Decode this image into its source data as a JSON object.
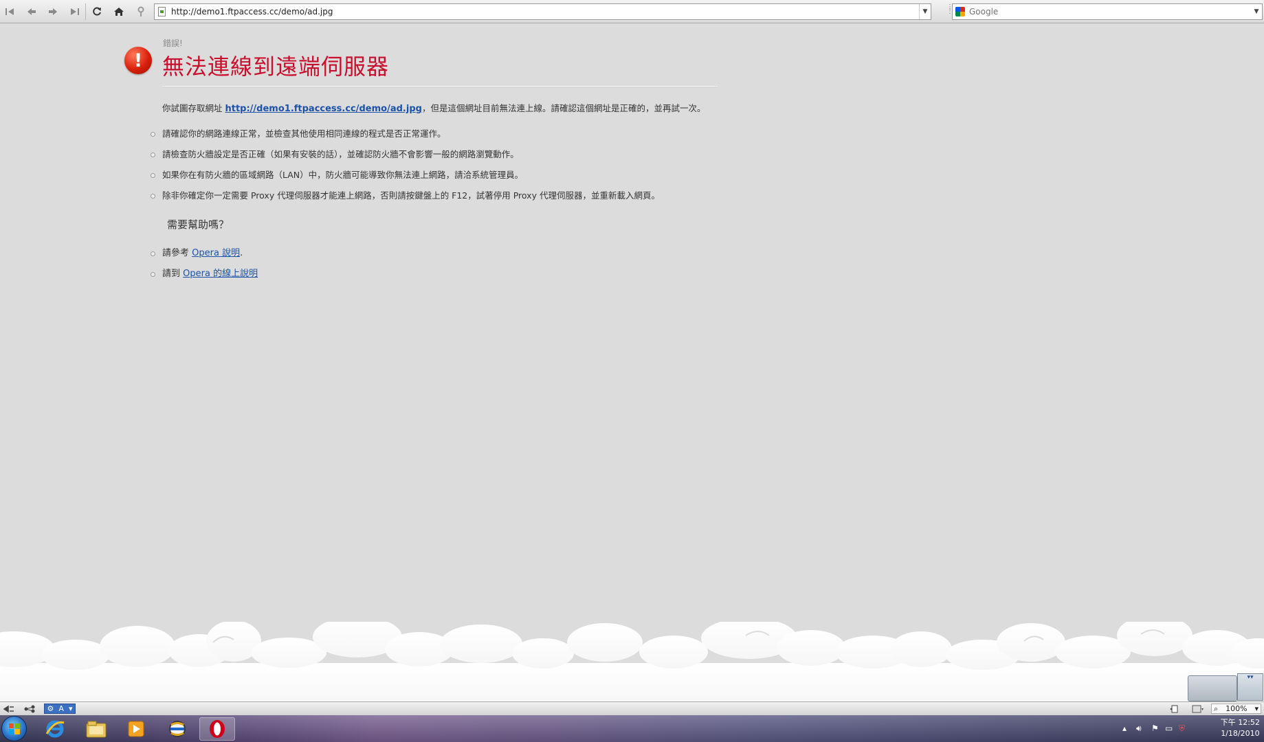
{
  "toolbar": {
    "address_value": "http://demo1.ftpaccess.cc/demo/ad.jpg",
    "search_placeholder": "Google",
    "icons": [
      "rewind-icon",
      "back-icon",
      "forward-icon",
      "fast-forward-icon",
      "reload-icon",
      "home-icon",
      "key-icon"
    ]
  },
  "error": {
    "label": "錯誤!",
    "title": "無法連線到遠端伺服器",
    "intro_prefix": "你試圖存取網址 ",
    "intro_link": "http://demo1.ftpaccess.cc/demo/ad.jpg",
    "intro_suffix": "，但是這個網址目前無法連上線。請確認這個網址是正確的，並再試一次。",
    "bullets": [
      "請確認你的網路連線正常，並檢查其他使用相同連線的程式是否正常運作。",
      "請檢查防火牆設定是否正確（如果有安裝的話），並確認防火牆不會影響一般的網路瀏覽動作。",
      "如果你在有防火牆的區域網路（LAN）中，防火牆可能導致你無法連上網路，請洽系統管理員。",
      "除非你確定你一定需要 Proxy 代理伺服器才能連上網路，否則請按鍵盤上的 F12，試著停用 Proxy 代理伺服器，並重新載入網頁。"
    ]
  },
  "help": {
    "heading": "需要幫助嗎？",
    "items": [
      {
        "prefix": "請參考 ",
        "link": "Opera 說明",
        "suffix": "."
      },
      {
        "prefix": "請到 ",
        "link": "Opera 的線上說明",
        "suffix": ""
      }
    ]
  },
  "statusbar": {
    "view_label": "A",
    "zoom": "100%"
  },
  "taskbar": {
    "apps": [
      "windows-start",
      "internet-explorer",
      "windows-explorer",
      "media-player",
      "ie-alt",
      "opera"
    ],
    "clock_time": "下午 12:52",
    "clock_date": "1/18/2010"
  },
  "colors": {
    "title_red": "#c8102e",
    "link_blue": "#1c52a8",
    "page_bg": "#dcdcdc"
  }
}
